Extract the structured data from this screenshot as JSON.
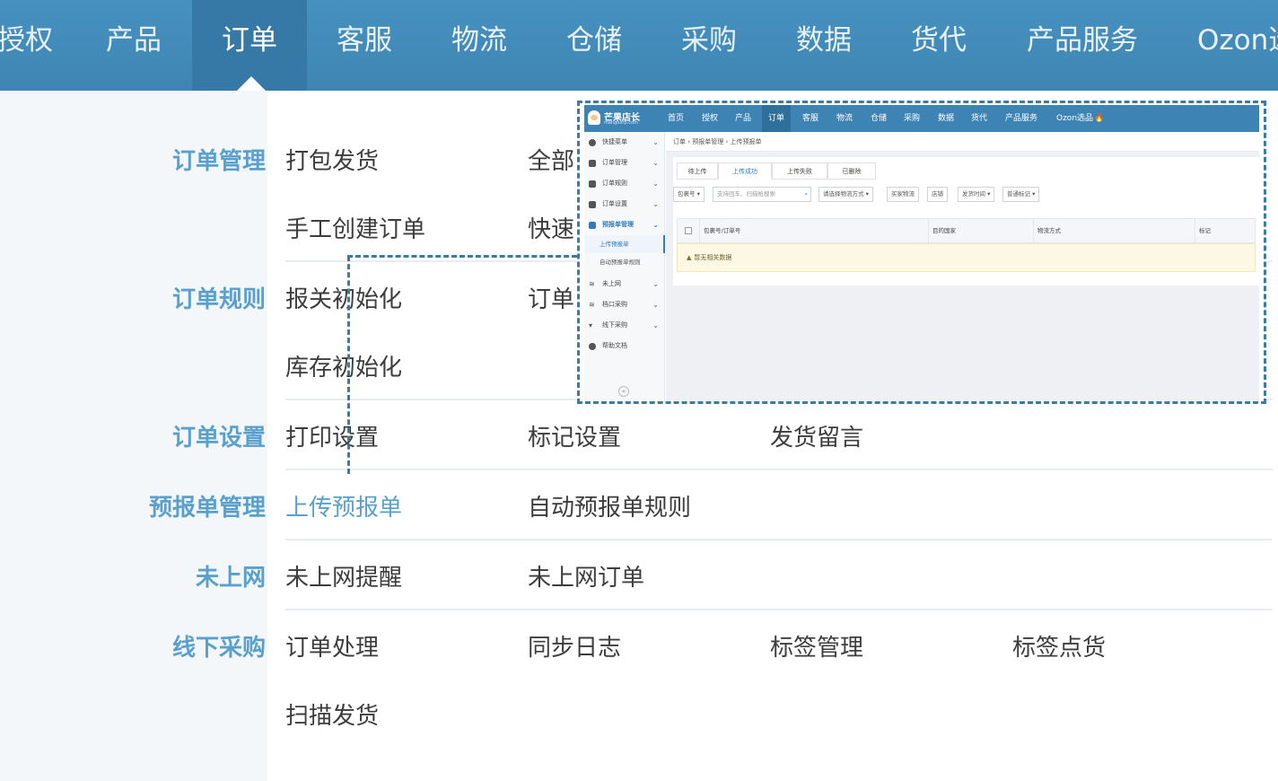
{
  "topnav": {
    "items": [
      "授权",
      "产品",
      "订单",
      "客服",
      "物流",
      "仓储",
      "采购",
      "数据",
      "货代",
      "产品服务",
      "Ozon选"
    ],
    "active_index": 2
  },
  "menu": {
    "categories": [
      "订单管理",
      "订单规则",
      "订单设置",
      "预报单管理",
      "未上网",
      "线下采购"
    ],
    "links": {
      "pack_ship": "打包发货",
      "all_prefix": "全部",
      "manual_create": "手工创建订单",
      "quick_prefix": "快速",
      "customs_init": "报关初始化",
      "order_prefix": "订单",
      "stock_init": "库存初始化",
      "print_settings": "打印设置",
      "mark_settings": "标记设置",
      "ship_message": "发货留言",
      "upload_forecast": "上传预报单",
      "auto_forecast_rules": "自动预报单规则",
      "offline_reminder": "未上网提醒",
      "offline_orders": "未上网订单",
      "order_processing": "订单处理",
      "sync_log": "同步日志",
      "label_management": "标签管理",
      "label_count": "标签点货",
      "scan_ship": "扫描发货"
    }
  },
  "inset": {
    "brand": "芒果店长",
    "brand_sub": "mangoerp.com",
    "nav": [
      "首页",
      "授权",
      "产品",
      "订单",
      "客服",
      "物流",
      "仓储",
      "采购",
      "数据",
      "货代",
      "产品服务",
      "Ozon选品"
    ],
    "nav_active_index": 3,
    "sidebar": {
      "quick_menu": "快捷菜单",
      "order_mgmt": "订单管理",
      "order_rules": "订单规则",
      "order_settings": "订单设置",
      "forecast_mgmt": "预报单管理",
      "upload_forecast": "上传预报单",
      "auto_forecast_rules": "自动预报单规则",
      "not_online": "未上网",
      "port_purchase": "档口采购",
      "offline_purchase": "线下采购",
      "help_docs": "帮助文档",
      "collapse": "«"
    },
    "breadcrumb": "订单 › 预报单管理 › 上传预报单",
    "tabs": [
      "待上传",
      "上传成功",
      "上传失败",
      "已删除"
    ],
    "tab_active_index": 1,
    "filters": {
      "package_no": "包裹号 ▾",
      "search_placeholder": "支持回车、扫描枪搜索",
      "logistics": "请选择物流方式 ▾",
      "buyer_logistics": "买家物流",
      "store": "店铺",
      "ship_time": "发货时间 ▾",
      "normal_mark": "普通标记 ▾"
    },
    "table_headers": [
      "包裹号/订单号",
      "目的国家",
      "物流方式",
      "标记"
    ],
    "empty_text": "暂无相关数据"
  },
  "colors": {
    "nav_bg": "#4691c0",
    "nav_active": "#3678a6",
    "category_text": "#5aa0cf",
    "dash_border": "#3a7ca5"
  }
}
